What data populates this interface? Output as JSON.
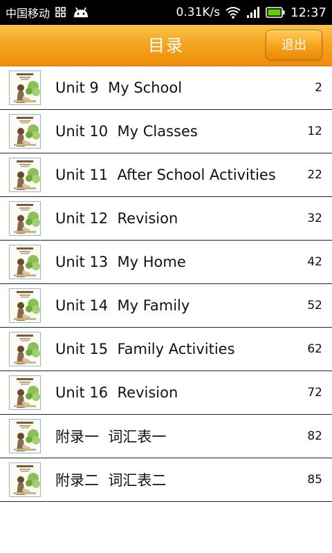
{
  "status_bar": {
    "carrier": "中国移动",
    "network_speed": "0.31K/s",
    "time": "12:37"
  },
  "header": {
    "title": "目录",
    "exit_label": "退出"
  },
  "toc": {
    "items": [
      {
        "title": "Unit 9  My School",
        "page": "2"
      },
      {
        "title": "Unit 10  My Classes",
        "page": "12"
      },
      {
        "title": "Unit 11  After School Activities",
        "page": "22"
      },
      {
        "title": "Unit 12  Revision",
        "page": "32"
      },
      {
        "title": "Unit 13  My Home",
        "page": "42"
      },
      {
        "title": "Unit 14  My Family",
        "page": "52"
      },
      {
        "title": "Unit 15  Family Activities",
        "page": "62"
      },
      {
        "title": "Unit 16  Revision",
        "page": "72"
      },
      {
        "title": "附录一  词汇表一",
        "page": "82"
      },
      {
        "title": "附录二  词汇表二",
        "page": "85"
      }
    ]
  },
  "colors": {
    "header_orange": "#f5a623",
    "status_bar": "#000000",
    "divider": "#222222",
    "battery_green": "#5fd000"
  },
  "icons": [
    "gallery-icon",
    "android-icon",
    "wifi-icon",
    "signal-icon",
    "battery-icon",
    "book-cover-thumbnail"
  ]
}
